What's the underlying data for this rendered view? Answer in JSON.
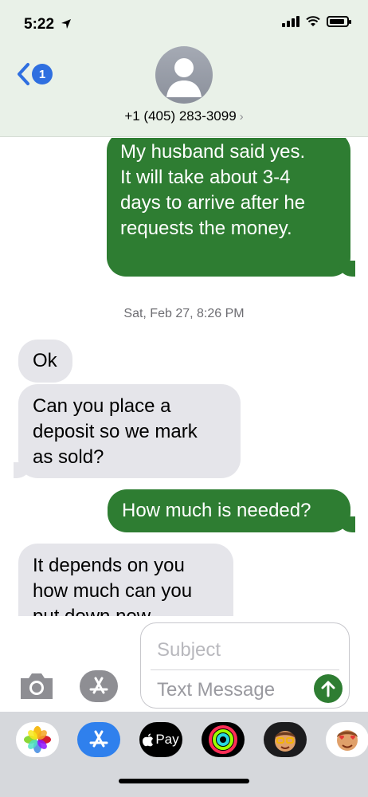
{
  "status_bar": {
    "time": "5:22",
    "location_icon": "location-arrow-icon",
    "icons": [
      "cellular-signal-icon",
      "wifi-icon",
      "battery-icon"
    ]
  },
  "header": {
    "back_icon": "chevron-left-icon",
    "back_badge": "1",
    "avatar_icon": "person-silhouette-icon",
    "contact_name": "+1 (405) 283-3099",
    "contact_chevron": "›"
  },
  "conversation": {
    "messages": [
      {
        "direction": "sent",
        "lines": [
          "My husband said yes.",
          "It will take about 3-4",
          "days to arrive after he",
          "requests the money."
        ]
      },
      {
        "direction": "timestamp",
        "text": "Sat, Feb 27, 8:26 PM"
      },
      {
        "direction": "received",
        "lines": [
          "Ok"
        ]
      },
      {
        "direction": "received",
        "lines": [
          "Can you place a",
          "deposit so we mark",
          "as sold?"
        ]
      },
      {
        "direction": "sent",
        "lines": [
          "How much is needed?"
        ]
      },
      {
        "direction": "received",
        "lines": [
          "It depends on you",
          "how much can you",
          "put down now"
        ]
      }
    ]
  },
  "composer": {
    "camera_icon": "camera-icon",
    "apps_icon": "app-store-icon",
    "subject_placeholder": "Subject",
    "message_placeholder": "Text Message",
    "send_icon": "arrow-up-icon"
  },
  "app_drawer": {
    "apps": [
      {
        "name": "photos-app-icon"
      },
      {
        "name": "app-store-app-icon"
      },
      {
        "name": "apple-pay-app-icon",
        "label": "Pay"
      },
      {
        "name": "activity-app-icon"
      },
      {
        "name": "memoji-app-icon"
      },
      {
        "name": "memoji-stickers-app-icon"
      }
    ]
  },
  "colors": {
    "sent_bubble": "#2e7d32",
    "received_bubble": "#e5e5ea",
    "header_bg": "#e9f1e8",
    "accent_blue": "#2f6fe0"
  }
}
